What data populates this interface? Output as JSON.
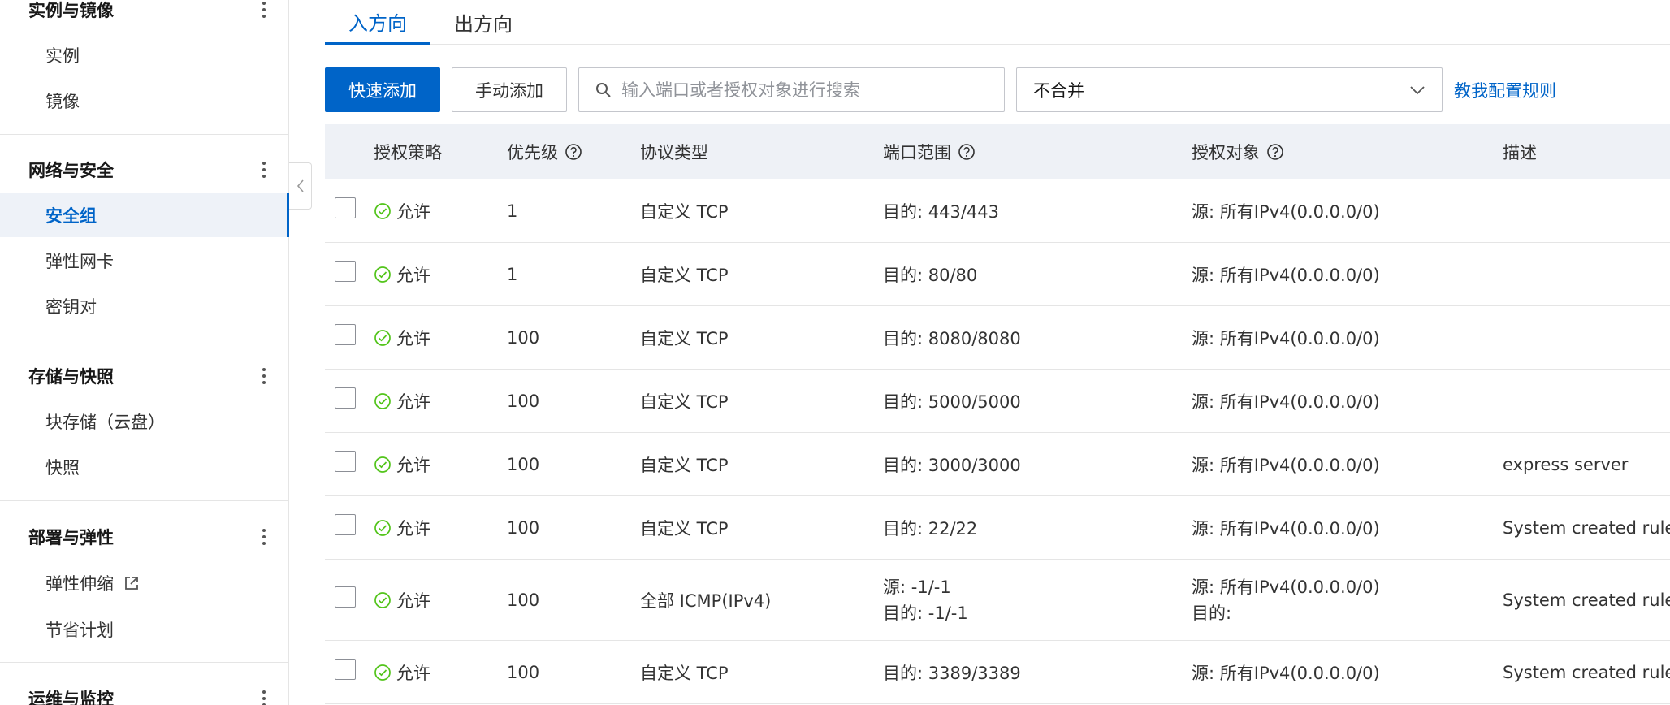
{
  "sidebar": {
    "sections": [
      {
        "title": "实例与镜像",
        "items": [
          "实例",
          "镜像"
        ]
      },
      {
        "title": "网络与安全",
        "items": [
          "安全组",
          "弹性网卡",
          "密钥对"
        ],
        "active": "安全组"
      },
      {
        "title": "存储与快照",
        "items": [
          "块存储（云盘）",
          "快照"
        ]
      },
      {
        "title": "部署与弹性",
        "items": [
          "弹性伸缩",
          "节省计划"
        ]
      },
      {
        "title": "运维与监控",
        "items": []
      }
    ]
  },
  "tabs": [
    "入方向",
    "出方向"
  ],
  "toolbar": {
    "quick_add": "快速添加",
    "manual_add": "手动添加",
    "search_placeholder": "输入端口或者授权对象进行搜索",
    "merge_select": "不合并",
    "help_link": "教我配置规则"
  },
  "table": {
    "columns": [
      "授权策略",
      "优先级",
      "协议类型",
      "端口范围",
      "授权对象",
      "描述"
    ],
    "rows": [
      {
        "policy": "允许",
        "priority": "1",
        "protocol": "自定义 TCP",
        "port": "目的: 443/443",
        "auth": "源: 所有IPv4(0.0.0.0/0)",
        "desc": ""
      },
      {
        "policy": "允许",
        "priority": "1",
        "protocol": "自定义 TCP",
        "port": "目的: 80/80",
        "auth": "源: 所有IPv4(0.0.0.0/0)",
        "desc": ""
      },
      {
        "policy": "允许",
        "priority": "100",
        "protocol": "自定义 TCP",
        "port": "目的: 8080/8080",
        "auth": "源: 所有IPv4(0.0.0.0/0)",
        "desc": ""
      },
      {
        "policy": "允许",
        "priority": "100",
        "protocol": "自定义 TCP",
        "port": "目的: 5000/5000",
        "auth": "源: 所有IPv4(0.0.0.0/0)",
        "desc": ""
      },
      {
        "policy": "允许",
        "priority": "100",
        "protocol": "自定义 TCP",
        "port": "目的: 3000/3000",
        "auth": "源: 所有IPv4(0.0.0.0/0)",
        "desc": "express server"
      },
      {
        "policy": "允许",
        "priority": "100",
        "protocol": "自定义 TCP",
        "port": "目的: 22/22",
        "auth": "源: 所有IPv4(0.0.0.0/0)",
        "desc": "System created rule."
      },
      {
        "policy": "允许",
        "priority": "100",
        "protocol": "全部 ICMP(IPv4)",
        "port": "源: -1/-1",
        "port2": "目的: -1/-1",
        "auth": "源: 所有IPv4(0.0.0.0/0)",
        "auth2": "目的:",
        "desc": "System created rule."
      },
      {
        "policy": "允许",
        "priority": "100",
        "protocol": "自定义 TCP",
        "port": "目的: 3389/3389",
        "auth": "源: 所有IPv4(0.0.0.0/0)",
        "desc": "System created rule."
      }
    ]
  },
  "colors": {
    "accent": "#0064c8",
    "allow": "#52c41a",
    "header_bg": "#eef1f6"
  },
  "icons": {
    "kebab": "more-vertical-icon",
    "external": "external-link-icon",
    "help": "question-circle-icon",
    "allow": "check-circle-icon",
    "search": "search-icon",
    "dropdown": "chevron-down-icon",
    "collapse": "chevron-left-icon"
  }
}
